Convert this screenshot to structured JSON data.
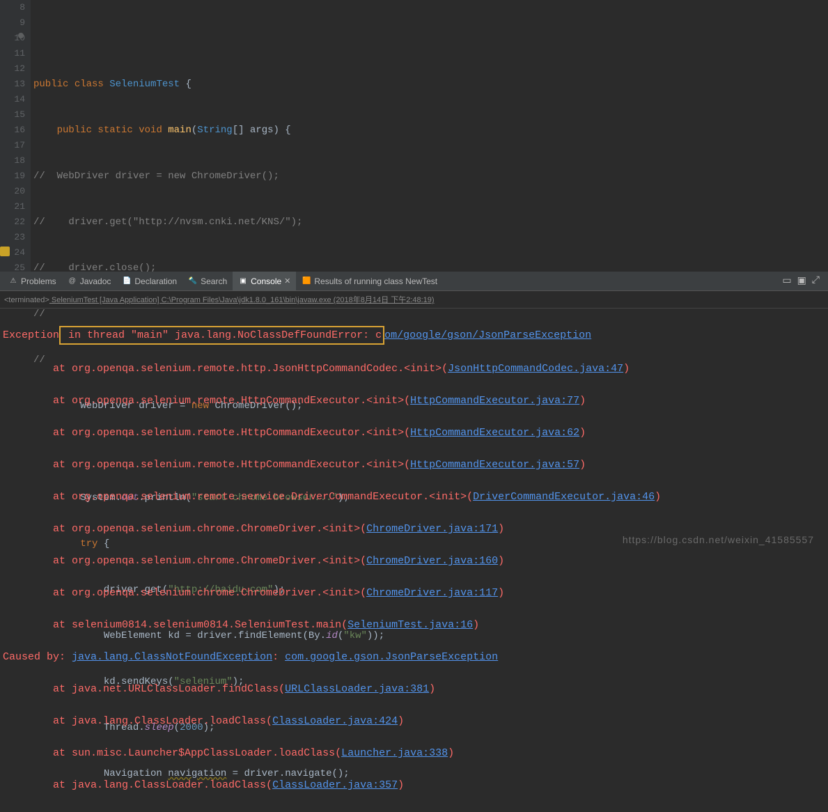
{
  "gutter": [
    "8",
    "9",
    "10",
    "11",
    "12",
    "13",
    "14",
    "15",
    "16",
    "17",
    "18",
    "19",
    "20",
    "21",
    "22",
    "23",
    "24",
    "25"
  ],
  "code": {
    "l9_1": "public",
    "l9_2": " class ",
    "l9_3": "SeleniumTest",
    "l9_4": " {",
    "l10_1": "    public",
    "l10_2": " static ",
    "l10_3": "void ",
    "l10_4": "main",
    "l10_5": "(",
    "l10_6": "String",
    "l10_7": "[] args) {",
    "l11": "//  WebDriver driver = new ChromeDriver();",
    "l12": "//    driver.get(\"http://nvsm.cnki.net/KNS/\");",
    "l13": "//    driver.close();",
    "l14": "//",
    "l15": "//",
    "l16_1": "        WebDriver driver = ",
    "l16_2": "new ",
    "l16_3": "ChromeDriver",
    "l16_4": "();",
    "l18_1": "        System.",
    "l18_2": "out",
    "l18_3": ".println(",
    "l18_4": "\"start chrome browser...\"",
    "l18_5": ");",
    "l19_1": "        try ",
    "l19_2": "{",
    "l20_1": "            driver.get(",
    "l20_2": "\"http://baidu.com\"",
    "l20_3": ");",
    "l21_1": "            WebElement kd = driver.findElement(By.",
    "l21_2": "id",
    "l21_3": "(",
    "l21_4": "\"kw\"",
    "l21_5": "));",
    "l22_1": "            kd.sendKeys(",
    "l22_2": "\"selenium\"",
    "l22_3": ");",
    "l23_1": "            Thread.",
    "l23_2": "sleep",
    "l23_3": "(",
    "l23_4": "2000",
    "l23_5": ");",
    "l24_1": "            Navigation ",
    "l24_2": "navigation",
    "l24_3": " = driver.navigate();"
  },
  "tabs": {
    "problems": "Problems",
    "javadoc": "Javadoc",
    "declaration": "Declaration",
    "search": "Search",
    "console": "Console",
    "results": "Results of running class NewTest"
  },
  "terminated": {
    "prefix": "<terminated>",
    "text": " SeleniumTest [Java Application] C:\\Program Files\\Java\\jdk1.8.0_161\\bin\\javaw.exe (2018年8月14日 下午2:48:19)"
  },
  "console": {
    "l1a": "Exception",
    "l1b": " in thread \"main\" java.lang.NoClassDefFoundError: c",
    "l1c": "om/google/gson/JsonParseException",
    "l2a": "        at org.openqa.selenium.remote.http.JsonHttpCommandCodec.<init>(",
    "l2b": "JsonHttpCommandCodec.java:47",
    "l2c": ")",
    "l3a": "        at org.openqa.selenium.remote.HttpCommandExecutor.<init>(",
    "l3b": "HttpCommandExecutor.java:77",
    "l3c": ")",
    "l4a": "        at org.openqa.selenium.remote.HttpCommandExecutor.<init>(",
    "l4b": "HttpCommandExecutor.java:62",
    "l4c": ")",
    "l5a": "        at org.openqa.selenium.remote.HttpCommandExecutor.<init>(",
    "l5b": "HttpCommandExecutor.java:57",
    "l5c": ")",
    "l6a": "        at org.openqa.selenium.remote.service.DriverCommandExecutor.<init>(",
    "l6b": "DriverCommandExecutor.java:46",
    "l6c": ")",
    "l7a": "        at org.openqa.selenium.chrome.ChromeDriver.<init>(",
    "l7b": "ChromeDriver.java:171",
    "l7c": ")",
    "l8a": "        at org.openqa.selenium.chrome.ChromeDriver.<init>(",
    "l8b": "ChromeDriver.java:160",
    "l8c": ")",
    "l9a": "        at org.openqa.selenium.chrome.ChromeDriver.<init>(",
    "l9b": "ChromeDriver.java:117",
    "l9c": ")",
    "l10a": "        at selenium0814.selenium0814.SeleniumTest.main(",
    "l10b": "SeleniumTest.java:16",
    "l10c": ")",
    "l11a": "Caused by: ",
    "l11b": "java.lang.ClassNotFoundException",
    "l11c": ": ",
    "l11d": "com.google.gson.JsonParseException",
    "l12a": "        at java.net.URLClassLoader.findClass(",
    "l12b": "URLClassLoader.java:381",
    "l12c": ")",
    "l13a": "        at java.lang.ClassLoader.loadClass(",
    "l13b": "ClassLoader.java:424",
    "l13c": ")",
    "l14a": "        at sun.misc.Launcher$AppClassLoader.loadClass(",
    "l14b": "Launcher.java:338",
    "l14c": ")",
    "l15a": "        at java.lang.ClassLoader.loadClass(",
    "l15b": "ClassLoader.java:357",
    "l15c": ")"
  },
  "watermark": "https://blog.csdn.net/weixin_41585557"
}
